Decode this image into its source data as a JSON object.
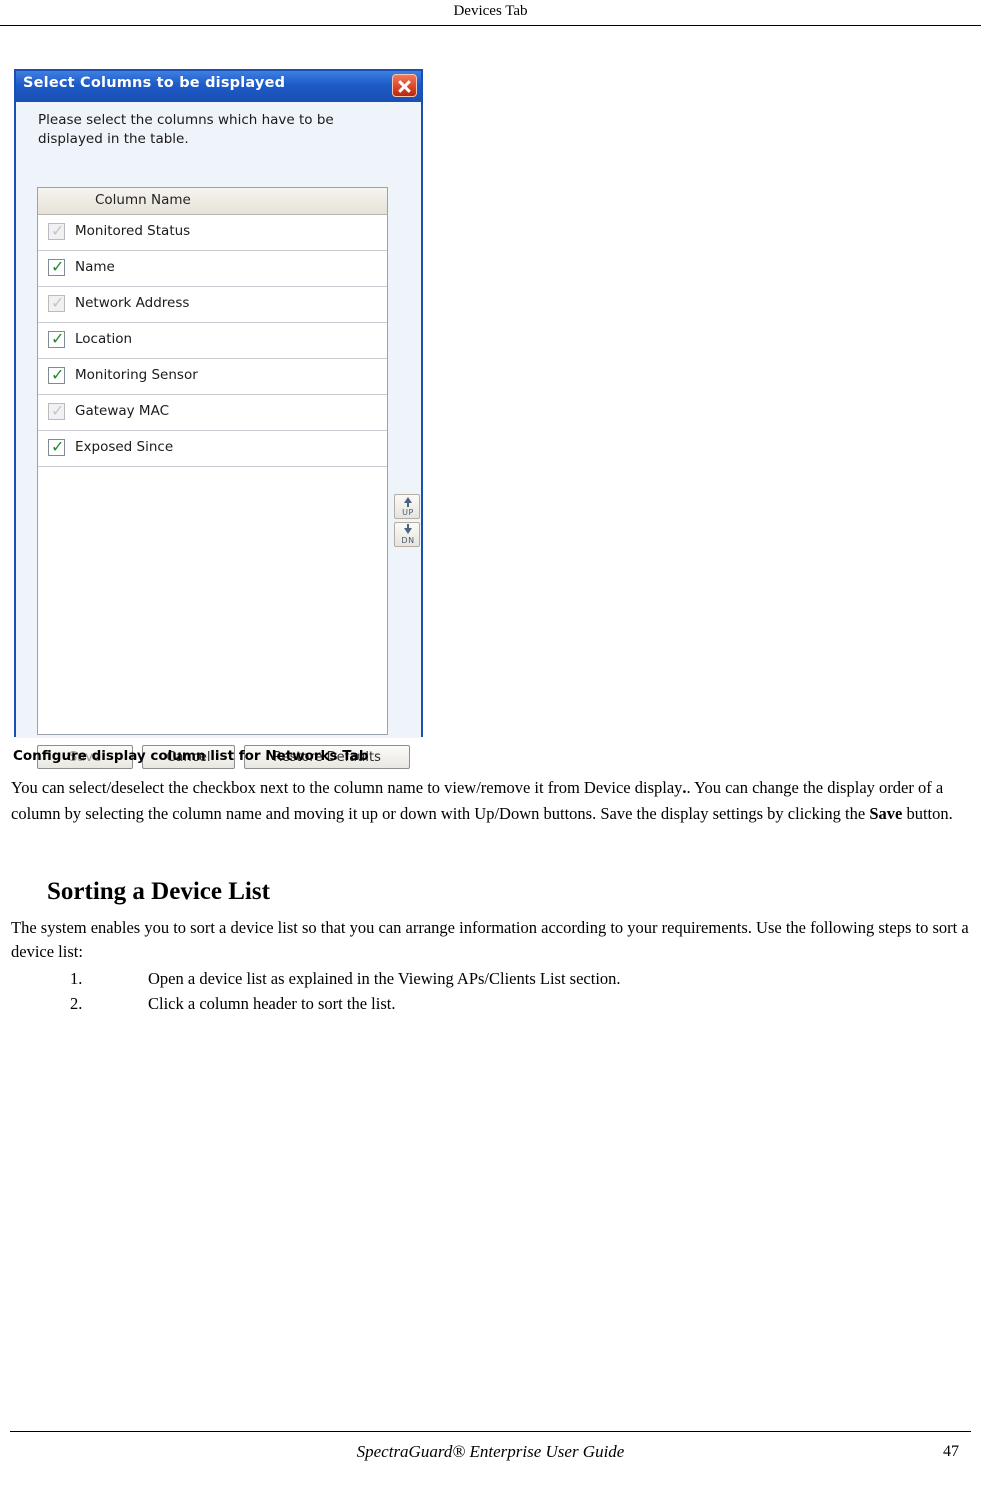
{
  "header": {
    "title": "Devices Tab"
  },
  "dialog": {
    "title": "Select Columns to be displayed",
    "close_icon": "close-icon",
    "instruction": "Please select the columns which have to be displayed in the table.",
    "table_header": "Column Name",
    "rows": [
      {
        "label": "Monitored Status",
        "checked": true,
        "enabled": false
      },
      {
        "label": "Name",
        "checked": true,
        "enabled": true
      },
      {
        "label": "Network Address",
        "checked": true,
        "enabled": false
      },
      {
        "label": "Location",
        "checked": true,
        "enabled": true
      },
      {
        "label": "Monitoring Sensor",
        "checked": true,
        "enabled": true
      },
      {
        "label": "Gateway MAC",
        "checked": true,
        "enabled": false
      },
      {
        "label": "Exposed Since",
        "checked": true,
        "enabled": true
      }
    ],
    "move_up_label": "UP",
    "move_down_label": "DN",
    "buttons": {
      "save": "Save",
      "cancel": "Cancel",
      "restore": "Restore Defaults"
    }
  },
  "content": {
    "caption": "Configure display column list for Networks Tab",
    "paragraph1_part1": " You can select/deselect the checkbox next to the column name to view/remove it from Device display",
    "paragraph1_part2": ". You can change the display order of a column by selecting the column name and moving it up or down with Up/Down buttons. Save the display settings by clicking the ",
    "paragraph1_bold": "Save",
    "paragraph1_part3": " button.",
    "heading": "Sorting a Device List",
    "paragraph2": "The system enables you to sort a device list so that you can arrange information according to your requirements. Use the following steps to sort a device list:",
    "steps": [
      {
        "num": "1.",
        "text": "Open a device list as explained in the Viewing APs/Clients List section."
      },
      {
        "num": "2.",
        "text": "Click a column header to sort the list."
      }
    ]
  },
  "footer": {
    "title": "SpectraGuard®  Enterprise User Guide",
    "page": "47"
  }
}
